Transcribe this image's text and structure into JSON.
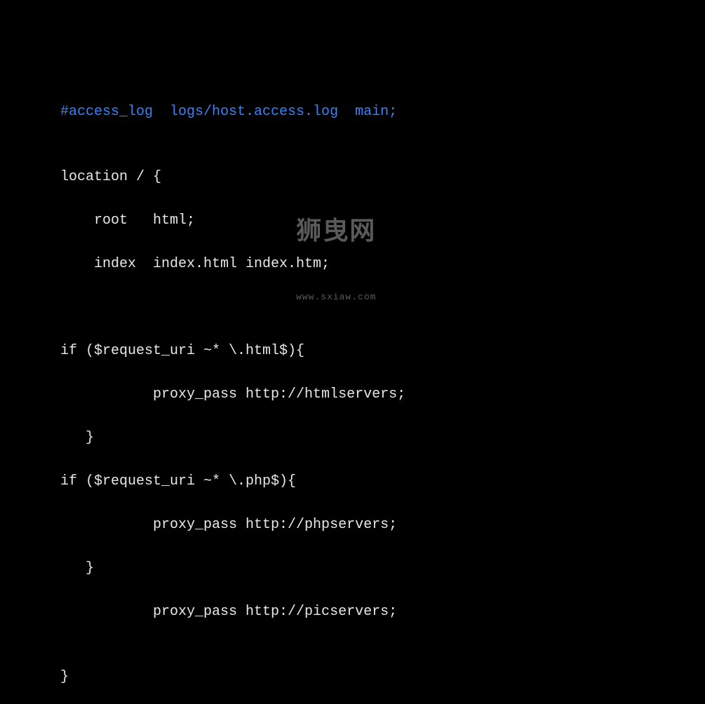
{
  "code": {
    "line1": "#access_log  logs/host.access.log  main;",
    "line2": "",
    "line3": "location / {",
    "line4": "    root   html;",
    "line5": "    index  index.html index.htm;",
    "line6": "",
    "line7": "",
    "line8": "if ($request_uri ~* \\.html$){",
    "line9": "           proxy_pass http://htmlservers;",
    "line10": "   }",
    "line11": "if ($request_uri ~* \\.php$){",
    "line12": "           proxy_pass http://phpservers;",
    "line13": "   }",
    "line14": "           proxy_pass http://picservers;",
    "line15": "",
    "line16": "}"
  },
  "watermark": {
    "title": "狮曳网",
    "url": "www.sxiaw.com"
  }
}
